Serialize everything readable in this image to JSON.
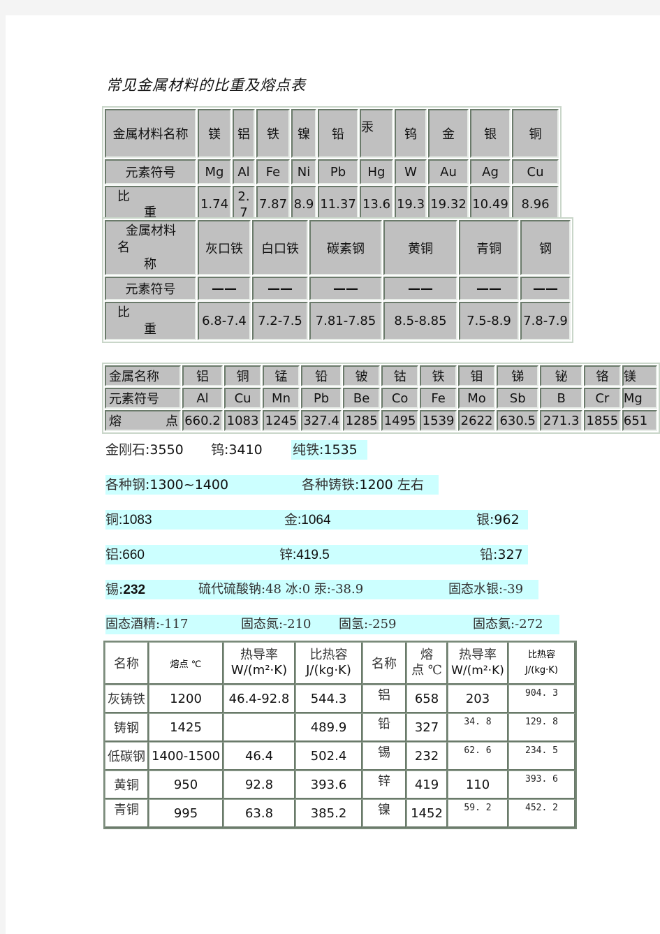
{
  "title": "常见金属材料的比重及熔点表",
  "table1": {
    "header_label": "金属材料名称",
    "names": [
      "镁",
      "铝",
      "铁",
      "镍",
      "铅",
      "汞",
      "钨",
      "金",
      "银",
      "铜"
    ],
    "symbol_label": "元素符号",
    "symbols": [
      "Mg",
      "Al",
      "Fe",
      "Ni",
      "Pb",
      "Hg",
      "W",
      "Au",
      "Ag",
      "Cu"
    ],
    "density_label_1": "比",
    "density_label_2": "重",
    "densities": [
      "1.74",
      "2.7",
      "7.87",
      "8.9",
      "11.37",
      "13.6",
      "19.3",
      "19.32",
      "10.49",
      "8.96"
    ]
  },
  "table2": {
    "header_label_1": "金属材料",
    "header_label_2": "名",
    "header_label_3": "称",
    "names": [
      "灰口铁",
      "白口铁",
      "碳素钢",
      "黄铜",
      "青铜",
      "钢"
    ],
    "symbol_label": "元素符号",
    "symbols": [
      "——",
      "——",
      "——",
      "——",
      "——",
      "——"
    ],
    "density_label_1": "比",
    "density_label_2": "重",
    "densities": [
      "6.8-7.4",
      "7.2-7.5",
      "7.81-7.85",
      "8.5-8.85",
      "7.5-8.9",
      "7.8-7.9"
    ]
  },
  "table3": {
    "name_label": "金属名称",
    "names": [
      "铝",
      "铜",
      "锰",
      "铅",
      "铍",
      "钴",
      "铁",
      "钼",
      "锑",
      "铋",
      "铬",
      "镁"
    ],
    "symbol_label": "元素符号",
    "symbols": [
      "Al",
      "Cu",
      "Mn",
      "Pb",
      "Be",
      "Co",
      "Fe",
      "Mo",
      "Sb",
      "B",
      "Cr",
      "Mg"
    ],
    "melt_label_1": "熔",
    "melt_label_2": "点",
    "melting_points": [
      "660.2",
      "1083",
      "1245",
      "327.4",
      "1285",
      "1495",
      "1539",
      "2622",
      "630.5",
      "271.3",
      "1855",
      "651"
    ]
  },
  "melting_lines": [
    [
      {
        "name": "金刚石",
        "value": "3550"
      },
      {
        "name": "钨",
        "value": "3410"
      },
      {
        "name": "纯铁",
        "value": "1535"
      }
    ],
    [
      {
        "name": "各种钢",
        "value": "1300~1400"
      },
      {
        "name": "各种铸铁",
        "value": "1200",
        "suffix": " 左右"
      }
    ],
    [
      {
        "name": "铜",
        "value": "1083"
      },
      {
        "name": "金",
        "value": "1064"
      },
      {
        "name": "银",
        "value": "962"
      }
    ],
    [
      {
        "name": "铝",
        "value": "660"
      },
      {
        "name": "锌",
        "value": "419.5"
      },
      {
        "name": "铅",
        "value": "327"
      }
    ],
    [
      {
        "name": "锡",
        "value": "232"
      },
      {
        "text": "硫代硫酸钠:48 冰:0 汞:-38.9"
      },
      {
        "text": "固态水银:-39"
      }
    ],
    [
      {
        "text": "固态酒精:-117"
      },
      {
        "text": "固态氮:-210"
      },
      {
        "text": "固氢:-259"
      },
      {
        "text": "固态氦:-272"
      }
    ]
  ],
  "table4": {
    "headers": {
      "name": "名称",
      "melt": "熔点 ℃",
      "cond_1": "热导率",
      "cond_2": "W/(m²·K)",
      "heat_1": "比热容",
      "heat_2": "J/(kg·K)",
      "name2": "名称",
      "melt2_1": "熔",
      "melt2_2": "点 ℃",
      "cond2_1": "热导率",
      "cond2_2": "W/(m²·K)",
      "heat2_1": "比热容",
      "heat2_2": "J/(kg·K)"
    },
    "rows": [
      {
        "name": "灰铸铁",
        "melt": "1200",
        "cond": "46.4-92.8",
        "heat": "544.3",
        "name2": "铝",
        "melt2": "658",
        "cond2": "203",
        "heat2": "904. 3"
      },
      {
        "name": "铸钢",
        "melt": "1425",
        "cond": "",
        "heat": "489.9",
        "name2": "铅",
        "melt2": "327",
        "cond2": "34. 8",
        "heat2": "129. 8"
      },
      {
        "name": "低碳钢",
        "melt": "1400-1500",
        "cond": "46.4",
        "heat": "502.4",
        "name2": "锡",
        "melt2": "232",
        "cond2": "62. 6",
        "heat2": "234. 5"
      },
      {
        "name": "黄铜",
        "melt": "950",
        "cond": "92.8",
        "heat": "393.6",
        "name2": "锌",
        "melt2": "419",
        "cond2": "110",
        "heat2": "393. 6"
      },
      {
        "name": "青铜",
        "melt": "995",
        "cond": "63.8",
        "heat": "385.2",
        "name2": "镍",
        "melt2": "1452",
        "cond2": "59. 2",
        "heat2": "452. 2"
      }
    ]
  }
}
